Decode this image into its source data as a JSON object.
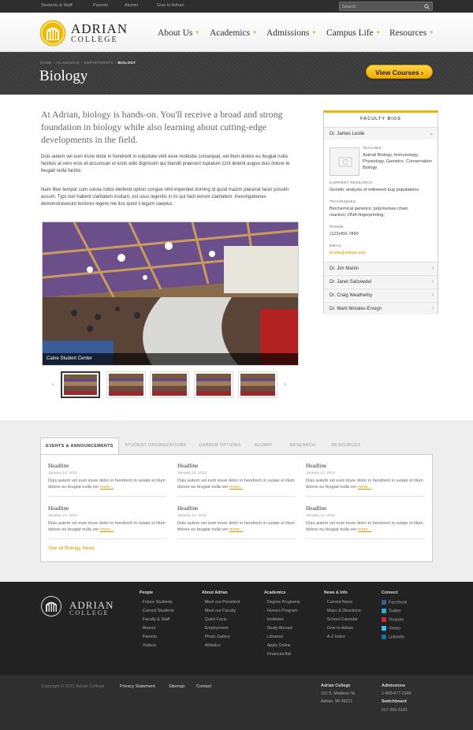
{
  "utility_bar": {
    "links": [
      "Students & Staff",
      "Parents",
      "Alumni",
      "Give to Adrian"
    ],
    "search_placeholder": "Search"
  },
  "header": {
    "logo_line1": "ADRIAN",
    "logo_line2": "COLLEGE",
    "nav": [
      "About Us",
      "Academics",
      "Admissions",
      "Campus Life",
      "Resources"
    ]
  },
  "hero": {
    "breadcrumb": [
      "HOME",
      "ACADEMICS",
      "DEPARTMENTS",
      "BIOLOGY"
    ],
    "title": "Biology",
    "cta": "View Courses"
  },
  "content": {
    "intro": "At Adrian, biology is hands-on. You'll receive a broad and strong foundation in biology while also learning about cutting-edge developments in the field.",
    "paragraph1": "Duis autem vel eum iriure dolor in hendrerit in vulputate velit esse molestie consequat, vel illum dolore eu feugiat nulla facilisis at vero eros et accumsan et iusto odio dignissim qui blandit praesent luptatum zzril delenit augue duis dolore te feugait nulla facilisi.",
    "paragraph2": "Nam liber tempor cum soluta nobis eleifend option congue nihil imperdiet doming id quod mazim placerat facer possim assum. Typi non habent claritatem insitam; est usus legentis in iis qui facit eorum claritatem. Investigationes demonstraverunt lectores legere me lius quod ii legunt saepius.",
    "photo_caption": "Caine Student Center"
  },
  "faculty": {
    "title": "FACULTY BIOS",
    "expanded": {
      "name": "Dr. James Leslie",
      "teaches_label": "TEACHES",
      "teaches": "Animal Biology, Immunology, Physiology, Genetics, Conservation Biology",
      "research_label": "CURRENT RESEARCH",
      "research": "Genetic analysis of milkweed bug populations",
      "techniques_label": "TECHNIQUES",
      "techniques": "Biochemical genetics; polymerase chain reaction; DNA fingerprinting;",
      "phone_label": "PHONE",
      "phone": "(123)456-7890",
      "email_label": "EMAIL",
      "email": "jleslie@adrian.edu"
    },
    "collapsed": [
      "Dr. Jim Martin",
      "Dr. Janet Salzwedel",
      "Dr. Craig Weatherby",
      "Dr. Marti Morales-Ensign"
    ]
  },
  "tabs": {
    "items": [
      "EVENTS & ANNOUNCEMENTS",
      "STUDENT ORGANIZATIONS",
      "CAREER OPTIONS",
      "ALUMNI",
      "RESEARCH",
      "RESOURCES"
    ],
    "active_index": 0,
    "news": [
      {
        "headline": "Headline",
        "date": "January 12, 2012",
        "body": "Duis autem vel eum iriure dolor in hendrerit in vutate el illum dolore eu feugiat nulla ver",
        "more": "more..."
      },
      {
        "headline": "Headline",
        "date": "January 12, 2012",
        "body": "Duis autem vel eum iriure dolor in hendrerit in vutate el illum dolore eu feugiat nulla ver",
        "more": "more..."
      },
      {
        "headline": "Headline",
        "date": "January 12, 2012",
        "body": "Duis autem vel eum iriure dolor in hendrerit in vutate el illum dolore eu feugiat nulla ver",
        "more": "more..."
      },
      {
        "headline": "Headline",
        "date": "January 12, 2012",
        "body": "Duis autem vel eum iriure dolor in hendrerit in vutate el illum dolore eu feugiat nulla ver",
        "more": "more..."
      },
      {
        "headline": "Headline",
        "date": "January 12, 2012",
        "body": "Duis autem vel eum iriure dolor in hendrerit in vutate el illum dolore eu feugiat nulla ver",
        "more": "more..."
      },
      {
        "headline": "Headline",
        "date": "January 12, 2012",
        "body": "Duis autem vel eum iriure dolor in hendrerit in vutate el illum dolore eu feugiat nulla ver",
        "more": "more..."
      }
    ],
    "see_all": "See all Biology News"
  },
  "footer": {
    "logo_line1": "ADRIAN",
    "logo_line2": "COLLEGE",
    "columns": [
      {
        "heading": "People",
        "links": [
          "Future Students",
          "Current Students",
          "Faculty & Staff",
          "Alumni",
          "Parents",
          "Visitors"
        ]
      },
      {
        "heading": "About Adrian",
        "links": [
          "Meet our President",
          "Meet our Faculty",
          "Quick Facts",
          "Employment",
          "Photo Gallery",
          "Athletics"
        ]
      },
      {
        "heading": "Academics",
        "links": [
          "Degree Programs",
          "Honors Program",
          "Institutes",
          "Study Abroad",
          "Libraries",
          "Apply Online",
          "Financial Aid"
        ]
      },
      {
        "heading": "News & Info",
        "links": [
          "Current News",
          "Maps & Directions",
          "School Calendar",
          "Give to Adrian",
          "A-Z Index"
        ]
      },
      {
        "heading": "Connect",
        "links": [
          "Facebook",
          "Twitter",
          "Youtube",
          "Vimeo",
          "Linkedin"
        ]
      }
    ],
    "social_colors": [
      "#3b5998",
      "#33a7d8",
      "#cc2b2b",
      "#44bbff",
      "#0e76a8"
    ]
  },
  "bottom": {
    "copyright": "Copyright © 2012 Adrian College",
    "links": [
      "Privacy Statement",
      "Sitemap",
      "Contact"
    ],
    "address_heading": "Adrian College",
    "address": [
      "110 S. Madison St.",
      "Adrian, MI 49221"
    ],
    "admissions_heading": "Admissions",
    "admissions_phone": "1-800-877-2246",
    "switchboard_heading": "Switchboard",
    "switchboard_phone": "517-265-5161"
  },
  "colors": {
    "accent": "#f0b400",
    "link": "#d09a00",
    "dark": "#222222"
  }
}
